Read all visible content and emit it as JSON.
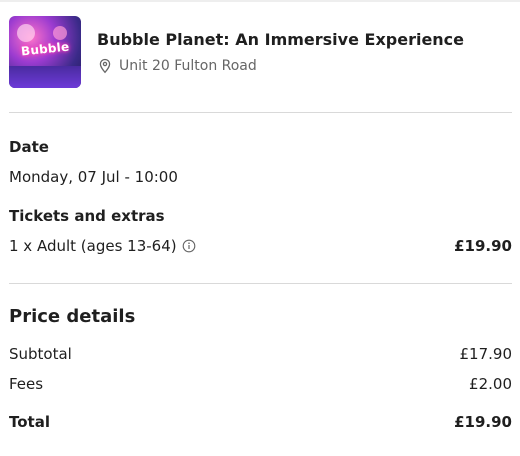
{
  "event": {
    "title": "Bubble Planet: An Immersive Experience",
    "address": "Unit 20 Fulton Road",
    "thumbnail_text": "Bubble"
  },
  "date_section": {
    "label": "Date",
    "value": "Monday, 07 Jul - 10:00"
  },
  "tickets_section": {
    "label": "Tickets and extras",
    "items": [
      {
        "description": "1 x Adult (ages 13-64)",
        "price": "£19.90"
      }
    ]
  },
  "price_details": {
    "heading": "Price details",
    "subtotal_label": "Subtotal",
    "subtotal_value": "£17.90",
    "fees_label": "Fees",
    "fees_value": "£2.00",
    "total_label": "Total",
    "total_value": "£19.90"
  },
  "icons": {
    "location": "map-pin-icon",
    "info": "info-circle-icon"
  },
  "colors": {
    "text": "#1f1f1f",
    "muted": "#666666",
    "divider": "#d9d9d9"
  }
}
